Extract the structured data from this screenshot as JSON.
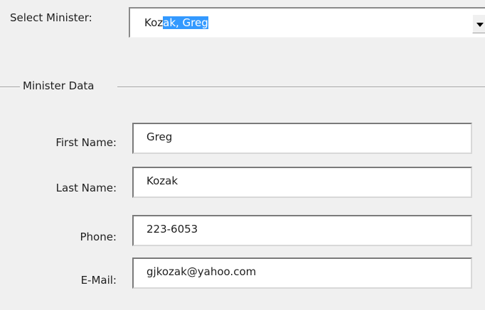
{
  "select_minister": {
    "label": "Select Minister:",
    "value_before_selection": "Koz",
    "value_selected": "ak, Greg"
  },
  "group": {
    "title": "Minister Data"
  },
  "fields": {
    "first_name": {
      "label": "First Name:",
      "value": "Greg"
    },
    "last_name": {
      "label": "Last Name:",
      "value": "Kozak"
    },
    "phone": {
      "label": "Phone:",
      "value": "223-6053"
    },
    "email": {
      "label": "E-Mail:",
      "value": "gjkozak@yahoo.com"
    }
  },
  "colors": {
    "window_background": "#f0f0f0",
    "selection_highlight": "#3399ff"
  }
}
